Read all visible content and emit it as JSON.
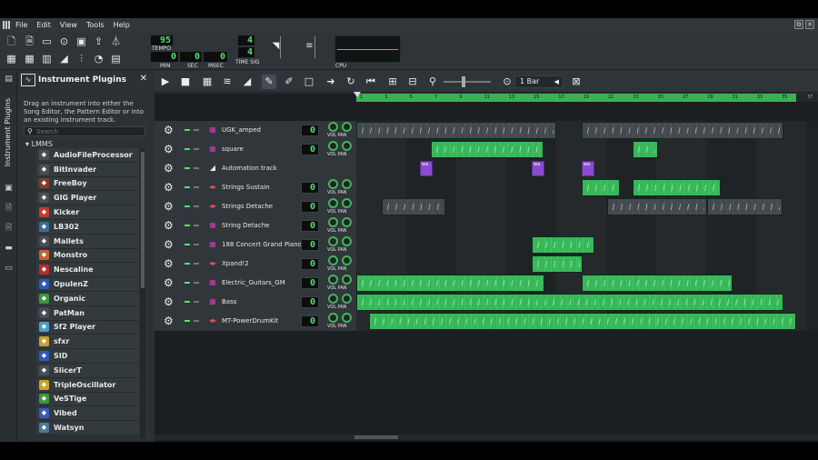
{
  "menu": [
    "File",
    "Edit",
    "View",
    "Tools",
    "Help"
  ],
  "window_buttons": [
    "⧉",
    "✕"
  ],
  "toolbar": {
    "tempo_value": "95",
    "tempo_label": "TEMPO",
    "time_min": "0",
    "time_sec": "0",
    "time_msec": "0",
    "min_label": "MIN",
    "sec_label": "SEC",
    "msec_label": "MSEC",
    "timesig_top": "4",
    "timesig_bottom": "4",
    "timesig_label": "TIME SIG",
    "cpu_label": "CPU"
  },
  "side_tab_label": "Instrument Plugins",
  "plugins_panel": {
    "title": "Instrument Plugins",
    "description": "Drag an instrument into either the Song Editor, the Pattern Editor or into an existing instrument track.",
    "search_placeholder": "Search",
    "tree_root": "LMMS",
    "items": [
      {
        "label": "AudioFileProcessor",
        "icon": "waveform-icon",
        "color": "#4a4f54"
      },
      {
        "label": "BitInvader",
        "icon": "bitinvader-icon",
        "color": "#4a4f54"
      },
      {
        "label": "FreeBoy",
        "icon": "gameboy-icon",
        "color": "#8a3b2b"
      },
      {
        "label": "GIG Player",
        "icon": "gig-icon",
        "color": "#4a4f54"
      },
      {
        "label": "Kicker",
        "icon": "kick-drum-icon",
        "color": "#c43b2a"
      },
      {
        "label": "LB302",
        "icon": "lb302-icon",
        "color": "#3b6a9a"
      },
      {
        "label": "Mallets",
        "icon": "mallets-icon",
        "color": "#4a4f54"
      },
      {
        "label": "Monstro",
        "icon": "monstro-icon",
        "color": "#c9612a"
      },
      {
        "label": "Nescaline",
        "icon": "nes-icon",
        "color": "#b82c2c"
      },
      {
        "label": "OpulenZ",
        "icon": "opulenz-icon",
        "color": "#2a5bb8"
      },
      {
        "label": "Organic",
        "icon": "organic-icon",
        "color": "#3a9a3a"
      },
      {
        "label": "PatMan",
        "icon": "patman-icon",
        "color": "#4a4f54"
      },
      {
        "label": "Sf2 Player",
        "icon": "soundfont-icon",
        "color": "#4aa0c9"
      },
      {
        "label": "sfxr",
        "icon": "sfxr-star-icon",
        "color": "#c9a22a"
      },
      {
        "label": "SID",
        "icon": "sid-icon",
        "color": "#2a5bb8"
      },
      {
        "label": "SlicerT",
        "icon": "slicer-icon",
        "color": "#4a4f54"
      },
      {
        "label": "TripleOscillator",
        "icon": "oscillator-icon",
        "color": "#c9a22a"
      },
      {
        "label": "VeSTige",
        "icon": "vestige-icon",
        "color": "#3a9a3a"
      },
      {
        "label": "Vibed",
        "icon": "vibed-icon",
        "color": "#3a5bb8"
      },
      {
        "label": "Watsyn",
        "icon": "watsyn-icon",
        "color": "#4a7a9a"
      }
    ]
  },
  "song_editor": {
    "snap_value": "1 Bar",
    "ruler_ticks": [
      "1",
      "3",
      "5",
      "7",
      "9",
      "11",
      "13",
      "15",
      "17",
      "19",
      "21",
      "23",
      "25",
      "27",
      "29",
      "31",
      "33",
      "35"
    ],
    "ruler_end_tick": "37",
    "tracks": [
      {
        "name": "UGK_amped",
        "icon": "instrument-icon",
        "icon_color": "#c93fb0",
        "volume": "0"
      },
      {
        "name": "square",
        "icon": "instrument-icon",
        "icon_color": "#c93fb0",
        "volume": "0"
      },
      {
        "name": "Automation track",
        "icon": "automation-icon",
        "icon_color": "#e8e8e8",
        "volume": ""
      },
      {
        "name": "Strings Sustain",
        "icon": "sf2-icon",
        "icon_color": "#e05050",
        "volume": "0"
      },
      {
        "name": "Strings Detache",
        "icon": "sf2-icon",
        "icon_color": "#e05050",
        "volume": "0"
      },
      {
        "name": "String Detache",
        "icon": "instrument-icon",
        "icon_color": "#c93fb0",
        "volume": "0"
      },
      {
        "name": "188 Concert Grand Piano",
        "icon": "instrument-icon",
        "icon_color": "#c93fb0",
        "volume": "0"
      },
      {
        "name": "Xpand!2",
        "icon": "sf2-icon",
        "icon_color": "#e05050",
        "volume": "0"
      },
      {
        "name": "Electric_Guitars_GM",
        "icon": "instrument-icon",
        "icon_color": "#c93fb0",
        "volume": "0"
      },
      {
        "name": "Bass",
        "icon": "instrument-icon",
        "icon_color": "#c93fb0",
        "volume": "0"
      },
      {
        "name": "MT-PowerDrumKit",
        "icon": "sf2-icon",
        "icon_color": "#e05050",
        "volume": "0"
      }
    ],
    "vol_pan_label": "VOL PAN",
    "automation_clip_label": "wa"
  }
}
